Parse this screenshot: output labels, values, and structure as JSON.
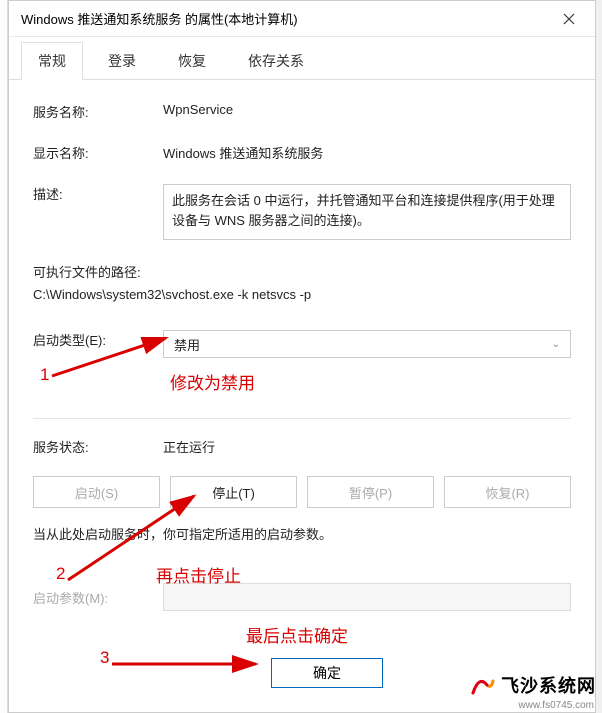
{
  "window": {
    "title": "Windows 推送通知系统服务 的属性(本地计算机)"
  },
  "tabs": {
    "general": "常规",
    "logon": "登录",
    "recovery": "恢复",
    "dependencies": "依存关系"
  },
  "fields": {
    "service_name_label": "服务名称:",
    "service_name_value": "WpnService",
    "display_name_label": "显示名称:",
    "display_name_value": "Windows 推送通知系统服务",
    "description_label": "描述:",
    "description_value": "此服务在会话 0 中运行，并托管通知平台和连接提供程序(用于处理设备与 WNS 服务器之间的连接)。",
    "exe_path_label": "可执行文件的路径:",
    "exe_path_value": "C:\\Windows\\system32\\svchost.exe -k netsvcs -p",
    "startup_type_label": "启动类型(E):",
    "startup_type_value": "禁用",
    "service_status_label": "服务状态:",
    "service_status_value": "正在运行",
    "start_params_hint": "当从此处启动服务时，你可指定所适用的启动参数。",
    "start_params_label": "启动参数(M):"
  },
  "buttons": {
    "start": "启动(S)",
    "stop": "停止(T)",
    "pause": "暂停(P)",
    "resume": "恢复(R)",
    "ok": "确定"
  },
  "annotations": {
    "num1": "1",
    "text1": "修改为禁用",
    "num2": "2",
    "text2": "再点击停止",
    "num3": "3",
    "text3": "最后点击确定"
  },
  "watermark": {
    "brand": "飞沙系统网",
    "url": "www.fs0745.com"
  }
}
